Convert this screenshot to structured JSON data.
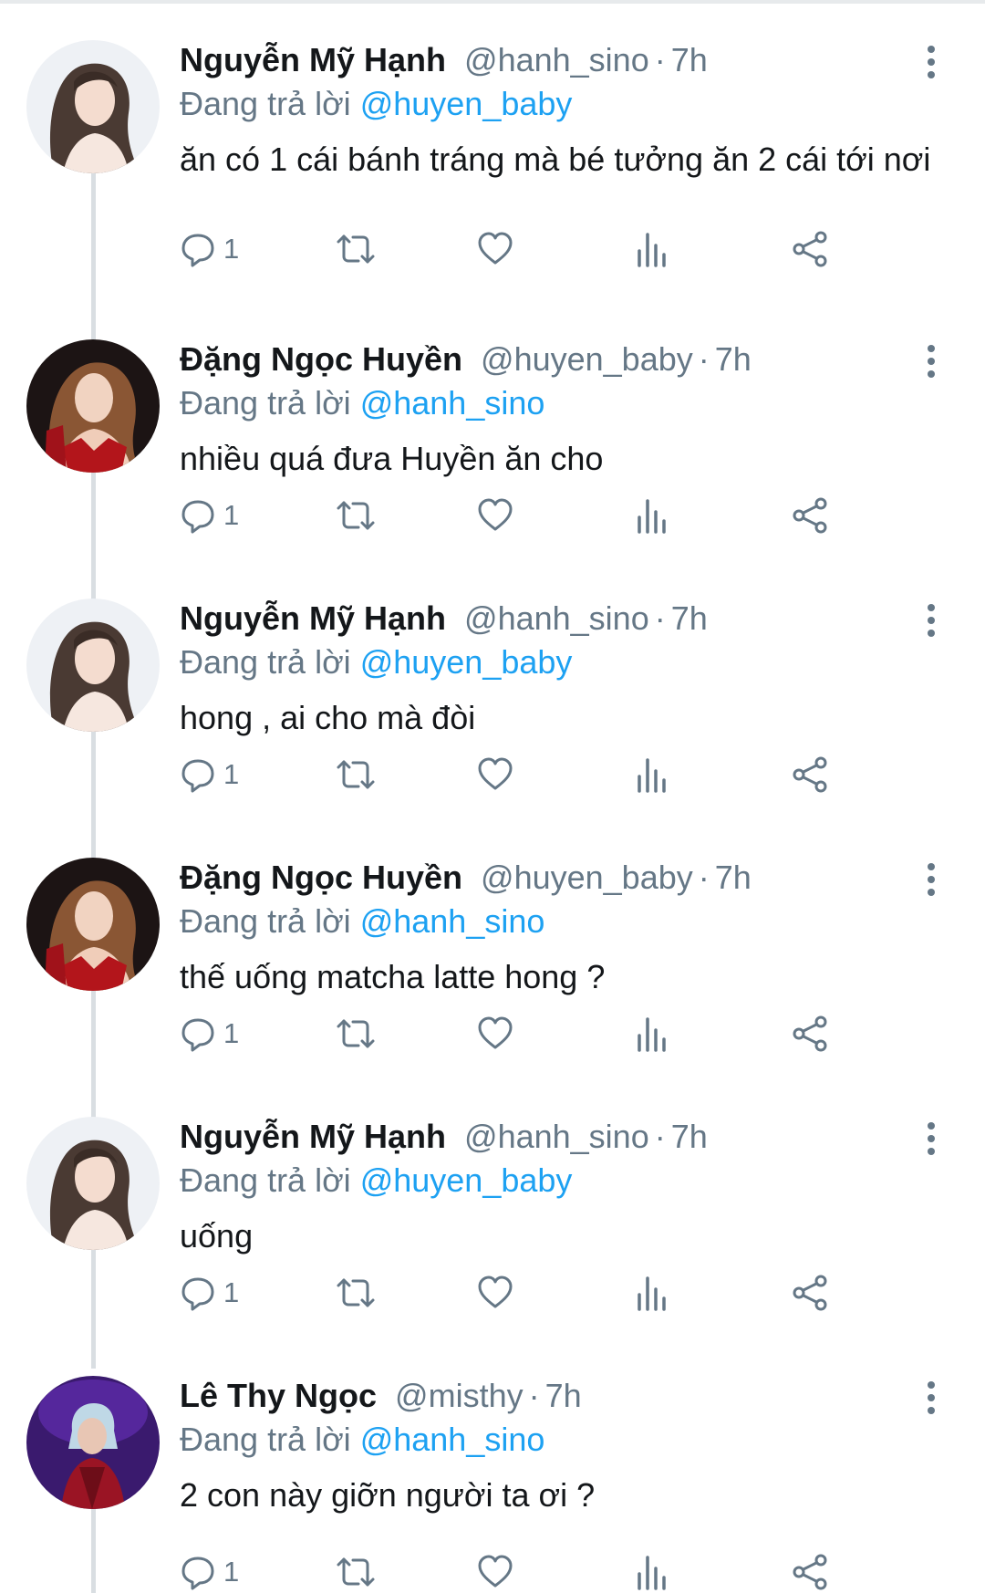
{
  "colors": {
    "name": "#14171a",
    "muted": "#657786",
    "mention": "#1da1f2",
    "thread_line": "#d9dee2"
  },
  "replying_prefix": "Đang trả lời",
  "tweets": [
    {
      "display_name": "Nguyễn Mỹ Hạnh",
      "handle": "@hanh_sino",
      "separator": "·",
      "time": "7h",
      "replying_to": "@huyen_baby",
      "text": "ăn có 1 cái bánh tráng mà bé tưởng ăn 2 cái tới nơi",
      "reply_count": "1",
      "avatar": "avatar-hanh"
    },
    {
      "display_name": "Đặng Ngọc Huyền",
      "handle": "@huyen_baby",
      "separator": "·",
      "time": "7h",
      "replying_to": "@hanh_sino",
      "text": "nhiều quá đưa Huyền ăn cho",
      "reply_count": "1",
      "avatar": "avatar-huyen"
    },
    {
      "display_name": "Nguyễn Mỹ Hạnh",
      "handle": "@hanh_sino",
      "separator": "·",
      "time": "7h",
      "replying_to": "@huyen_baby",
      "text": "hong , ai cho mà đòi",
      "reply_count": "1",
      "avatar": "avatar-hanh"
    },
    {
      "display_name": "Đặng Ngọc Huyền",
      "handle": "@huyen_baby",
      "separator": "·",
      "time": "7h",
      "replying_to": "@hanh_sino",
      "text": "thế uống matcha latte hong ?",
      "reply_count": "1",
      "avatar": "avatar-huyen"
    },
    {
      "display_name": "Nguyễn Mỹ Hạnh",
      "handle": "@hanh_sino",
      "separator": "·",
      "time": "7h",
      "replying_to": "@huyen_baby",
      "text": "uống",
      "reply_count": "1",
      "avatar": "avatar-hanh"
    },
    {
      "display_name": "Lê Thy Ngọc",
      "handle": "@misthy",
      "separator": "·",
      "time": "7h",
      "replying_to": "@hanh_sino",
      "text": "2 con này giỡn người ta ơi ?",
      "reply_count": "1",
      "avatar": "avatar-misthy"
    }
  ],
  "icons": {
    "reply": "reply-icon",
    "retweet": "retweet-icon",
    "like": "heart-icon",
    "analytics": "analytics-icon",
    "share": "share-icon",
    "more": "more-vertical-icon"
  }
}
